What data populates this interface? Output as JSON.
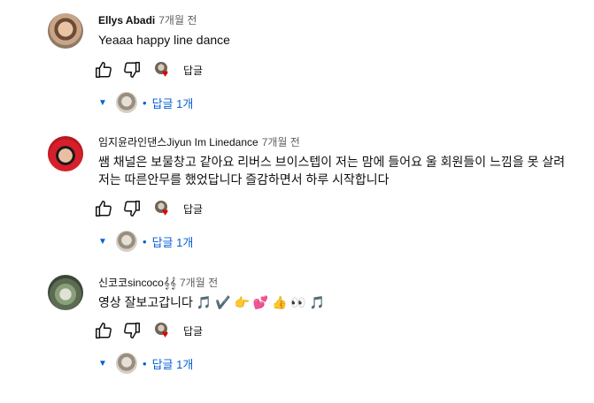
{
  "comments": [
    {
      "author": "Ellys Abadi",
      "time": "7개월 전",
      "text": "Yeaaa happy line dance",
      "reply_label": "답글",
      "replies_label": "답글 1개"
    },
    {
      "author": "임지윤라인댄스Jiyun Im Linedance",
      "time": "7개월 전",
      "text": "쌤 채널은 보물창고 같아요 리버스 브이스텝이 저는 맘에 들어요 울 회원들이 느낌을 못 살려 저는 따른안무를 했었답니다  즐감하면서 하루 시작합니다",
      "reply_label": "답글",
      "replies_label": "답글 1개"
    },
    {
      "author": "신코코sincoco𝄞𝄞",
      "time": "7개월 전",
      "text": "영상 잘보고갑니다 🎵 ✔️ 👉 💕 👍 👀 🎵",
      "reply_label": "답글",
      "replies_label": "답글 1개"
    }
  ],
  "icons": {
    "like": "thumb-up-icon",
    "dislike": "thumb-down-icon",
    "heart": "creator-heart-icon",
    "expand": "caret-down-icon"
  },
  "colors": {
    "link": "#065fd4",
    "heart": "#e00000",
    "meta": "#606060"
  }
}
